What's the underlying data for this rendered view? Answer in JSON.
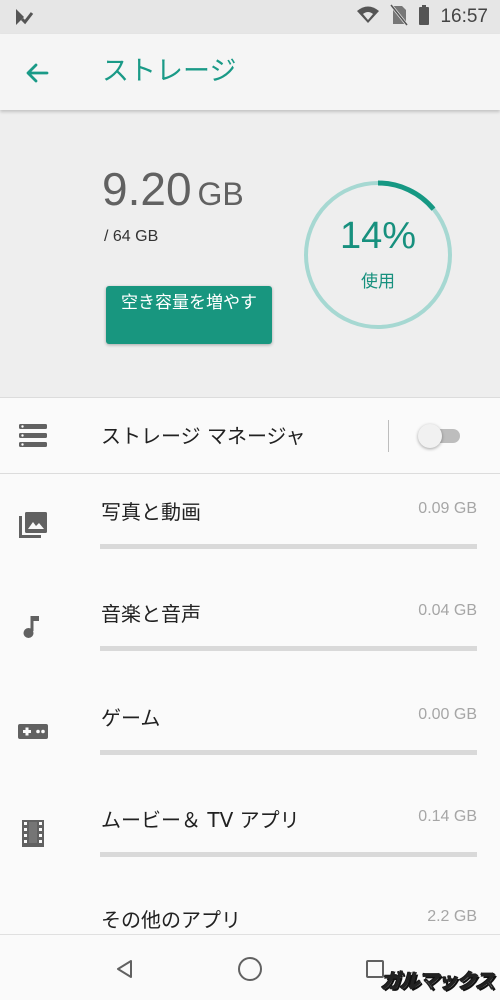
{
  "status_bar": {
    "time": "16:57"
  },
  "app_bar": {
    "title": "ストレージ"
  },
  "summary": {
    "used_value": "9.20",
    "used_unit": "GB",
    "total": "/ 64 GB",
    "free_up_button": "空き容量を増やす",
    "percent_label": "14%",
    "percent_caption": "使用",
    "used_fraction": 0.14
  },
  "storage_manager": {
    "label": "ストレージ マネージャ",
    "enabled": false
  },
  "categories": [
    {
      "name": "写真と動画",
      "size": "0.09 GB",
      "icon": "photo-icon"
    },
    {
      "name": "音楽と音声",
      "size": "0.04 GB",
      "icon": "music-note-icon"
    },
    {
      "name": "ゲーム",
      "size": "0.00 GB",
      "icon": "gamepad-icon"
    },
    {
      "name": "ムービー＆ TV アプリ",
      "size": "0.14 GB",
      "icon": "movie-icon"
    },
    {
      "name": "その他のアプリ",
      "size": "2.2 GB",
      "icon": "apps-icon"
    }
  ],
  "watermark": "ガルマックス",
  "colors": {
    "accent": "#1a9a87",
    "button": "#18967f",
    "ring": "#a6d8d2"
  }
}
